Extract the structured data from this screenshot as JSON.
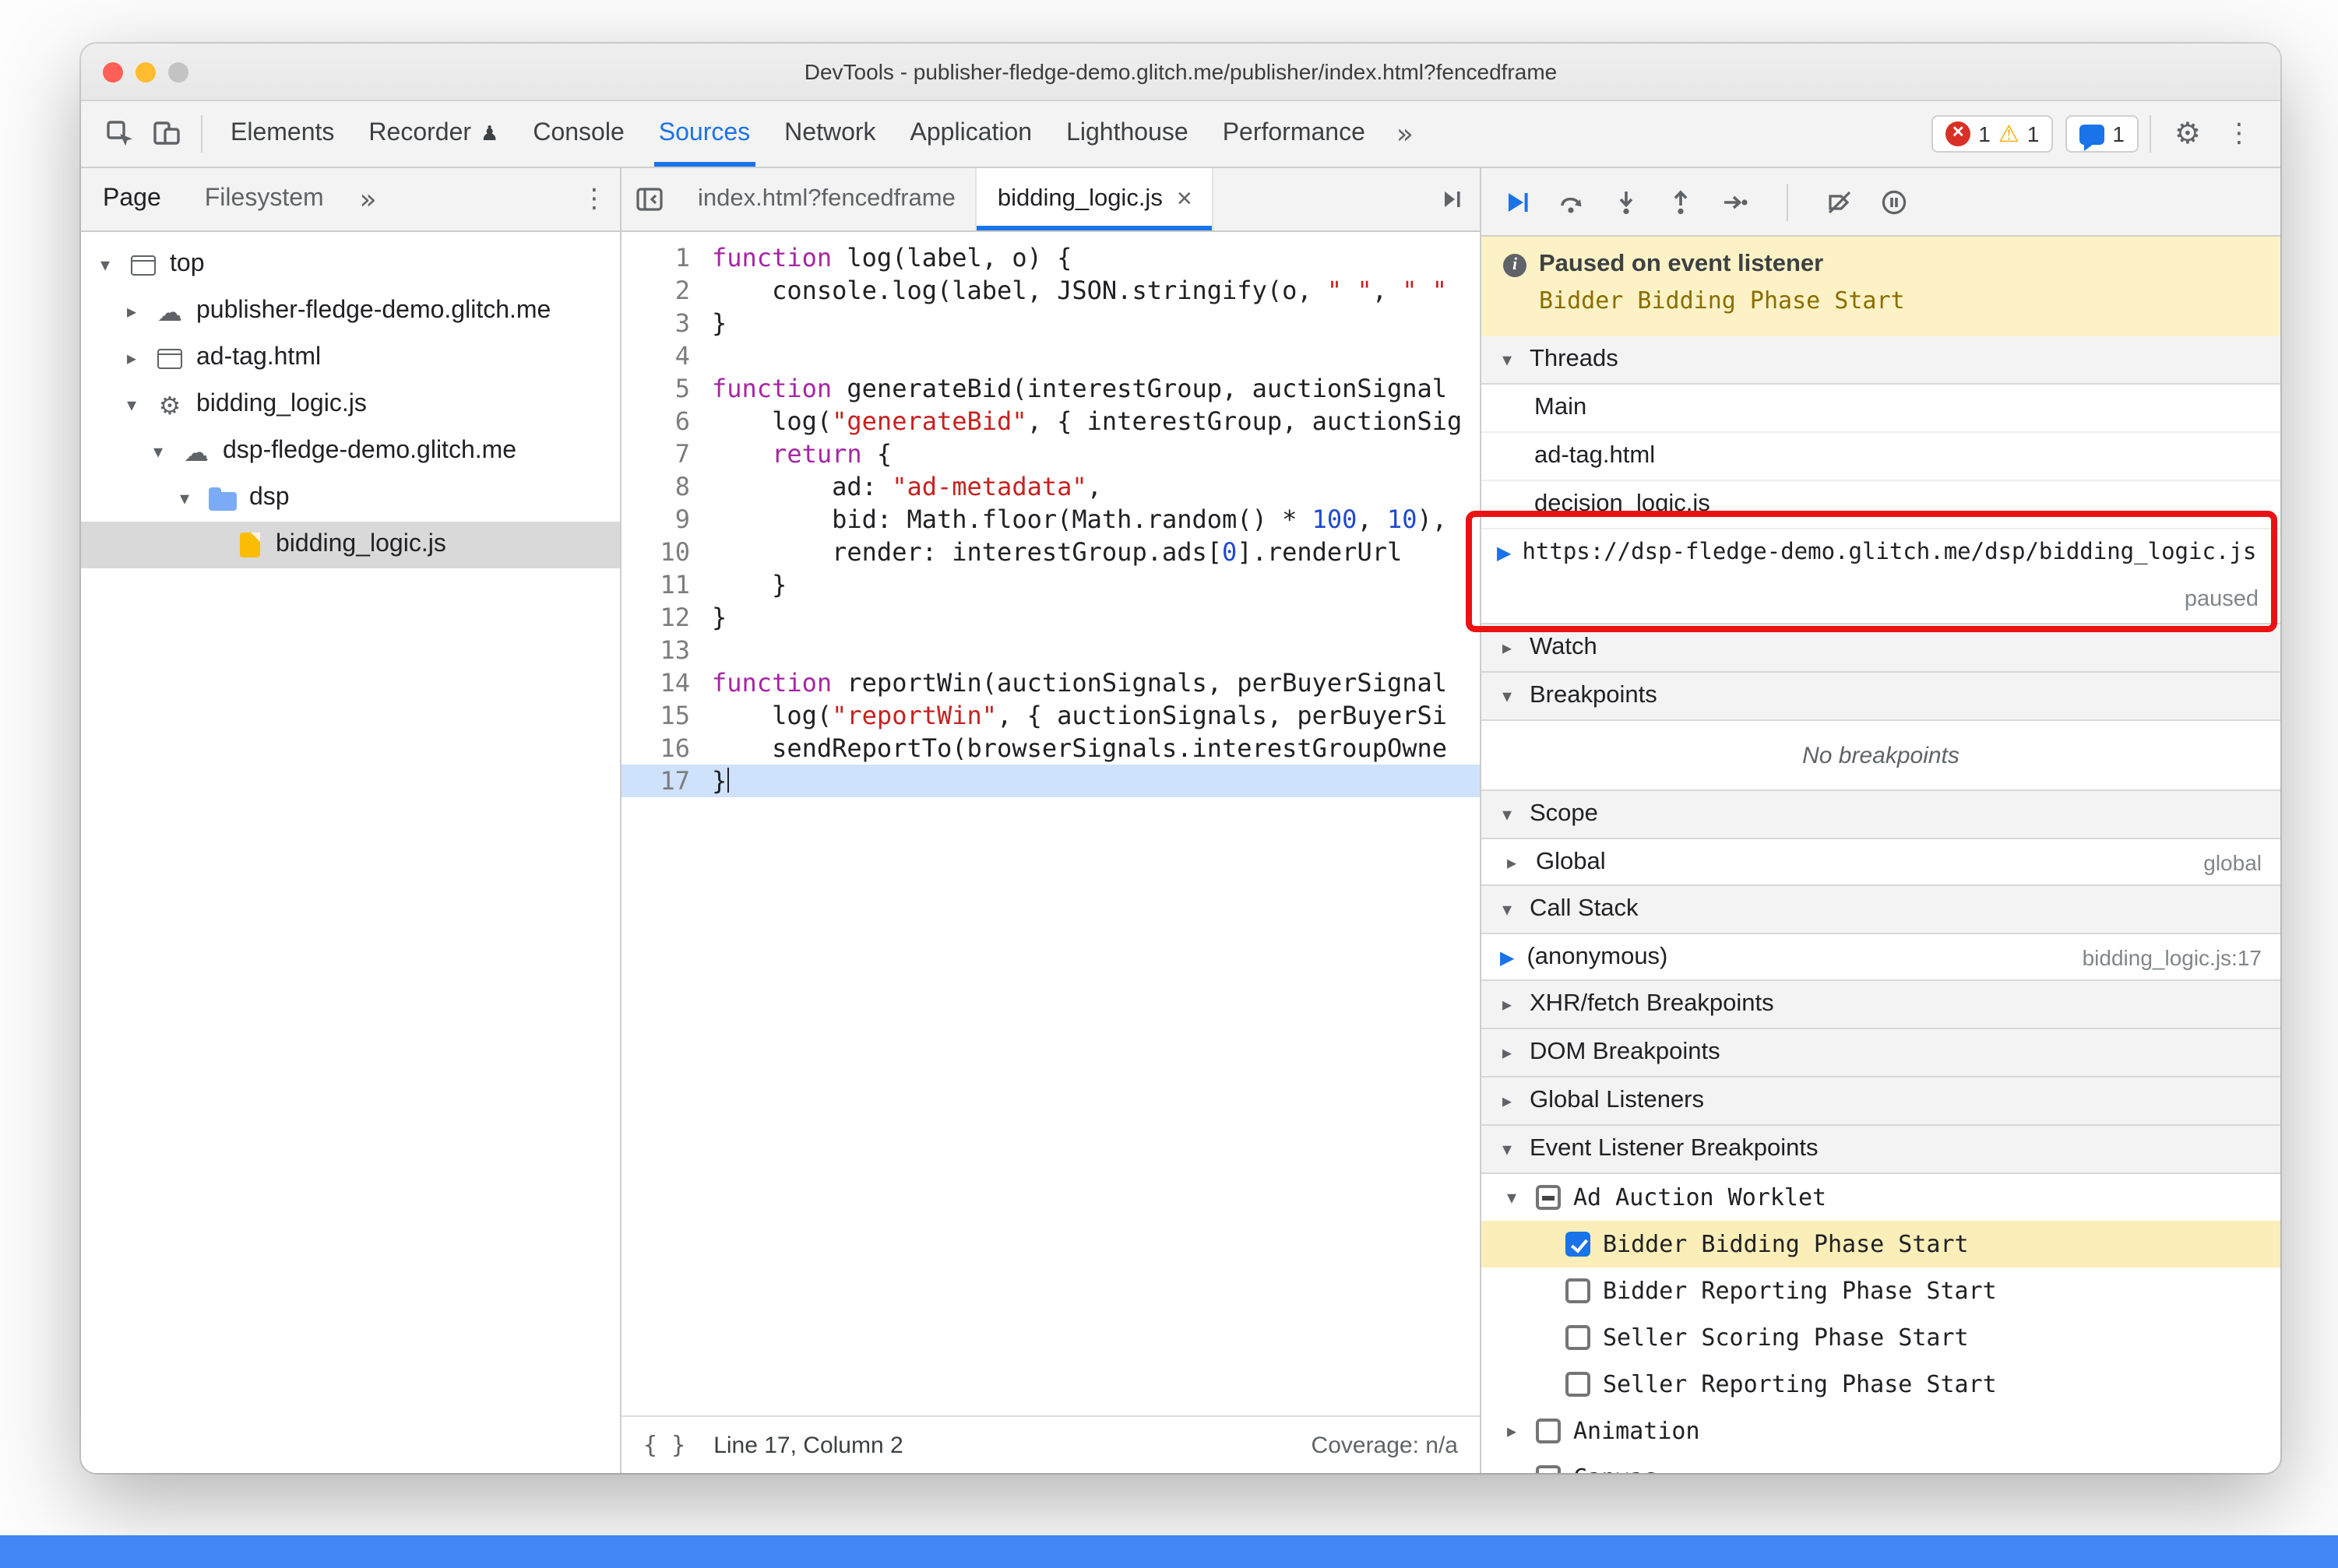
{
  "colors": {
    "accent": "#1a73e8",
    "error": "#d93025",
    "warning": "#f9ab00",
    "annotation": "#ea1212",
    "banner_bg": "#fdf2c5",
    "banner_text": "#8a6d00",
    "exec_line_bg": "#cfe2fb",
    "highlight_row_bg": "#fbeeb8",
    "selection_bg": "#d9d9d9",
    "bottom_strip": "#4285f4",
    "folder": "#7baaf7",
    "file": "#fbbc04"
  },
  "window": {
    "title": "DevTools - publisher-fledge-demo.glitch.me/publisher/index.html?fencedframe",
    "traffic_lights": [
      "#ff5f57",
      "#febc2e",
      "#c3c3c3"
    ]
  },
  "chrome_tabs": {
    "items": [
      {
        "label": "Elements"
      },
      {
        "label": "Recorder",
        "experiment": true
      },
      {
        "label": "Console"
      },
      {
        "label": "Sources",
        "active": true
      },
      {
        "label": "Network"
      },
      {
        "label": "Application"
      },
      {
        "label": "Lighthouse"
      },
      {
        "label": "Performance"
      }
    ],
    "more": "»"
  },
  "badges": {
    "errors": "1",
    "warnings": "1",
    "issues": "1"
  },
  "navigator": {
    "tabs": [
      {
        "label": "Page",
        "active": true
      },
      {
        "label": "Filesystem"
      }
    ],
    "more": "»",
    "menu": "⋮",
    "tree": [
      {
        "label": "top",
        "icon": "frame",
        "arrow": "down",
        "depth": 0
      },
      {
        "label": "publisher-fledge-demo.glitch.me",
        "icon": "cloud",
        "arrow": "right",
        "depth": 1
      },
      {
        "label": "ad-tag.html",
        "icon": "frame",
        "arrow": "right",
        "depth": 1
      },
      {
        "label": "bidding_logic.js",
        "icon": "gear",
        "arrow": "down",
        "depth": 1
      },
      {
        "label": "dsp-fledge-demo.glitch.me",
        "icon": "cloud",
        "arrow": "down",
        "depth": 2
      },
      {
        "label": "dsp",
        "icon": "folder",
        "arrow": "down",
        "depth": 3
      },
      {
        "label": "bidding_logic.js",
        "icon": "file",
        "arrow": "none",
        "depth": 4,
        "selected": true
      }
    ]
  },
  "editor": {
    "tabs": [
      {
        "label": "index.html?fencedframe"
      },
      {
        "label": "bidding_logic.js",
        "active": true,
        "close": "×"
      }
    ],
    "lines": [
      [
        [
          "k",
          "function"
        ],
        [
          "p",
          " log(label, o) {"
        ]
      ],
      [
        [
          "p",
          "    console.log(label, JSON.stringify(o, "
        ],
        [
          "s",
          "\" \""
        ],
        [
          "p",
          ", "
        ],
        [
          "s",
          "\" \""
        ]
      ],
      [
        [
          "p",
          "}"
        ]
      ],
      [],
      [
        [
          "k",
          "function"
        ],
        [
          "p",
          " generateBid(interestGroup, auctionSignal"
        ]
      ],
      [
        [
          "p",
          "    log("
        ],
        [
          "s",
          "\"generateBid\""
        ],
        [
          "p",
          ", { interestGroup, auctionSig"
        ]
      ],
      [
        [
          "p",
          "    "
        ],
        [
          "k",
          "return"
        ],
        [
          "p",
          " {"
        ]
      ],
      [
        [
          "p",
          "        ad: "
        ],
        [
          "s",
          "\"ad-metadata\""
        ],
        [
          "p",
          ","
        ]
      ],
      [
        [
          "p",
          "        bid: Math.floor(Math.random() * "
        ],
        [
          "n",
          "100"
        ],
        [
          "p",
          ", "
        ],
        [
          "n",
          "10"
        ],
        [
          "p",
          "),"
        ]
      ],
      [
        [
          "p",
          "        render: interestGroup.ads["
        ],
        [
          "n",
          "0"
        ],
        [
          "p",
          "].renderUrl"
        ]
      ],
      [
        [
          "p",
          "    }"
        ]
      ],
      [
        [
          "p",
          "}"
        ]
      ],
      [],
      [
        [
          "k",
          "function"
        ],
        [
          "p",
          " reportWin(auctionSignals, perBuyerSignal"
        ]
      ],
      [
        [
          "p",
          "    log("
        ],
        [
          "s",
          "\"reportWin\""
        ],
        [
          "p",
          ", { auctionSignals, perBuyerSi"
        ]
      ],
      [
        [
          "p",
          "    sendReportTo(browserSignals.interestGroupOwne"
        ]
      ],
      [
        [
          "p",
          "}"
        ]
      ]
    ],
    "paused_line": 17,
    "status": {
      "pretty_print": "{ }",
      "line_col": "Line 17, Column 2",
      "coverage": "Coverage: n/a"
    }
  },
  "debugger": {
    "banner": {
      "title": "Paused on event listener",
      "subtitle": "Bidder Bidding Phase Start"
    },
    "threads": {
      "header": "Threads",
      "items": [
        "Main",
        "ad-tag.html",
        "decision_logic.js"
      ],
      "active": {
        "url": "https://dsp-fledge-demo.glitch.me/dsp/bidding_logic.js",
        "status": "paused"
      }
    },
    "watch": {
      "header": "Watch"
    },
    "breakpoints": {
      "header": "Breakpoints",
      "empty": "No breakpoints"
    },
    "scope": {
      "header": "Scope",
      "rows": [
        {
          "label": "Global",
          "value": "global"
        }
      ]
    },
    "call_stack": {
      "header": "Call Stack",
      "rows": [
        {
          "label": "(anonymous)",
          "value": "bidding_logic.js:17",
          "current": true
        }
      ]
    },
    "collapsed": [
      "XHR/fetch Breakpoints",
      "DOM Breakpoints",
      "Global Listeners"
    ],
    "event_listener_breakpoints": {
      "header": "Event Listener Breakpoints",
      "groups": [
        {
          "label": "Ad Auction Worklet",
          "checkbox": "indeterminate",
          "expanded": true,
          "children": [
            {
              "label": "Bidder Bidding Phase Start",
              "checked": true,
              "highlighted": true
            },
            {
              "label": "Bidder Reporting Phase Start",
              "checked": false
            },
            {
              "label": "Seller Scoring Phase Start",
              "checked": false
            },
            {
              "label": "Seller Reporting Phase Start",
              "checked": false
            }
          ]
        },
        {
          "label": "Animation",
          "checkbox": "unchecked",
          "expanded": false
        },
        {
          "label": "Canvas",
          "checkbox": "unchecked",
          "expanded": false
        }
      ]
    }
  }
}
